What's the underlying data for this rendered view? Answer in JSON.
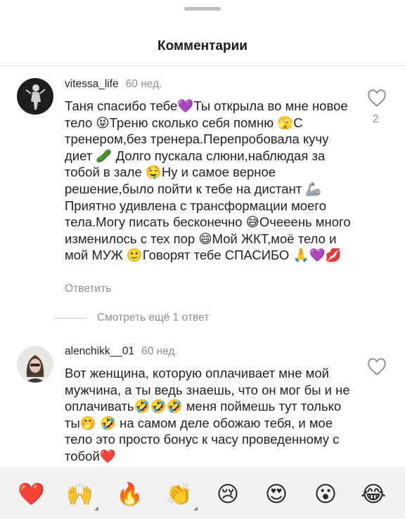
{
  "header": {
    "title": "Комментарии"
  },
  "comments": [
    {
      "username": "vitessa_life",
      "time": "60 нед.",
      "text": "Таня спасибо тебе💜Ты открыла во мне новое тело 😝Треню сколько себя помню 🫣С тренером,без тренера.Перепробовала кучу диет 🥒 Долго пускала слюни,наблюдая за тобой в зале 🤤Ну и самое верное решение,было пойти к тебе на дистант 🦾Приятно удивлена с трансформации моего тела.Могу писать бесконечно 😅Очееень много изменилось с тех пор 😄Мой ЖКТ,моё тело и мой МУЖ 🙂Говорят тебе СПАСИБО 🙏💜💋",
      "reply_label": "Ответить",
      "likes": "2",
      "avatar_icon": "woman-silhouette-dark"
    },
    {
      "username": "alenchikk__01",
      "time": "60 нед.",
      "text": "Вот женщина, которую оплачивает мне мой мужчина, а ты ведь знаешь, что он мог бы и не оплачивать🤣🤣🤣 меня поймешь тут только ты🤭 🤣 на самом деле обожаю тебя, и мое тело это просто бонус к часу проведенному с тобой❤️",
      "avatar_icon": "woman-portrait-light"
    }
  ],
  "view_more": {
    "label": "Смотреть ещё 1 ответ"
  },
  "reactions": [
    {
      "emoji": "❤️",
      "name": "heart"
    },
    {
      "emoji": "🙌",
      "name": "raised-hands",
      "has_variants": true
    },
    {
      "emoji": "🔥",
      "name": "fire"
    },
    {
      "emoji": "👏",
      "name": "clapping-hands",
      "has_variants": true
    },
    {
      "emoji": "😢",
      "name": "crying-face"
    },
    {
      "emoji": "😍",
      "name": "heart-eyes"
    },
    {
      "emoji": "😮",
      "name": "surprised-face"
    },
    {
      "emoji": "😂",
      "name": "tears-of-joy"
    }
  ],
  "colors": {
    "background": "#ffffff",
    "muted_text": "#8e8e8e",
    "primary_text": "#262626",
    "reaction_bar": "#f2f2f2"
  }
}
